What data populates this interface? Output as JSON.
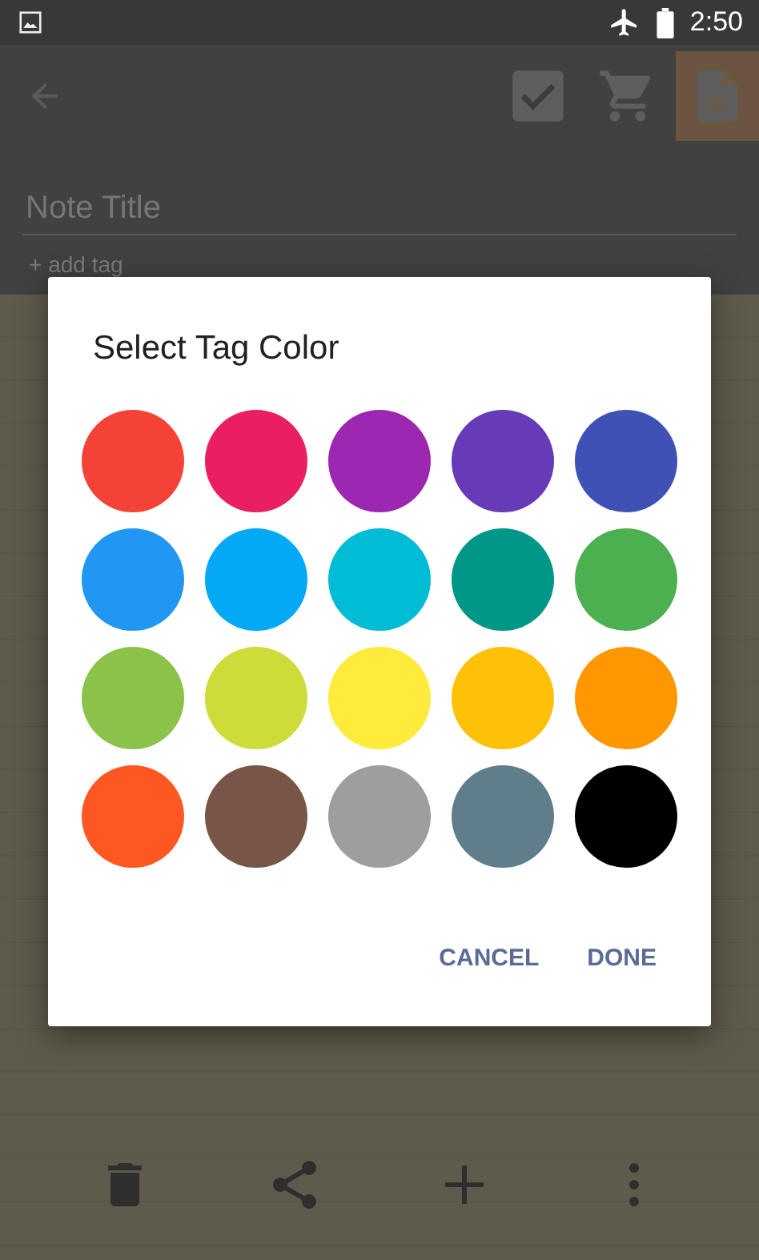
{
  "status_bar": {
    "time": "2:50"
  },
  "toolbar": {
    "modes": [
      {
        "kind": "checklist",
        "selected": false
      },
      {
        "kind": "shopping",
        "selected": false
      },
      {
        "kind": "note",
        "selected": true
      }
    ]
  },
  "note": {
    "title_placeholder": "Note Title",
    "add_tag": "+ add tag"
  },
  "dialog": {
    "title": "Select Tag Color",
    "colors": [
      {
        "color": "#f44336"
      },
      {
        "color": "#e91e63"
      },
      {
        "color": "#9c27b0"
      },
      {
        "color": "#673ab7"
      },
      {
        "color": "#3f51b5"
      },
      {
        "color": "#2196f3"
      },
      {
        "color": "#03a9f4"
      },
      {
        "color": "#00bcd4"
      },
      {
        "color": "#009688"
      },
      {
        "color": "#4caf50"
      },
      {
        "color": "#8bc34a"
      },
      {
        "color": "#cddc39"
      },
      {
        "color": "#ffeb3b"
      },
      {
        "color": "#ffc107"
      },
      {
        "color": "#ff9800"
      },
      {
        "color": "#ff5722"
      },
      {
        "color": "#795548"
      },
      {
        "color": "#9e9e9e"
      },
      {
        "color": "#607d8b"
      },
      {
        "color": "#000000"
      }
    ],
    "buttons": [
      "CANCEL",
      "DONE"
    ]
  },
  "bottom_bar": {
    "actions": [
      {
        "kind": "delete"
      },
      {
        "kind": "share"
      },
      {
        "kind": "add"
      },
      {
        "kind": "more"
      }
    ]
  }
}
